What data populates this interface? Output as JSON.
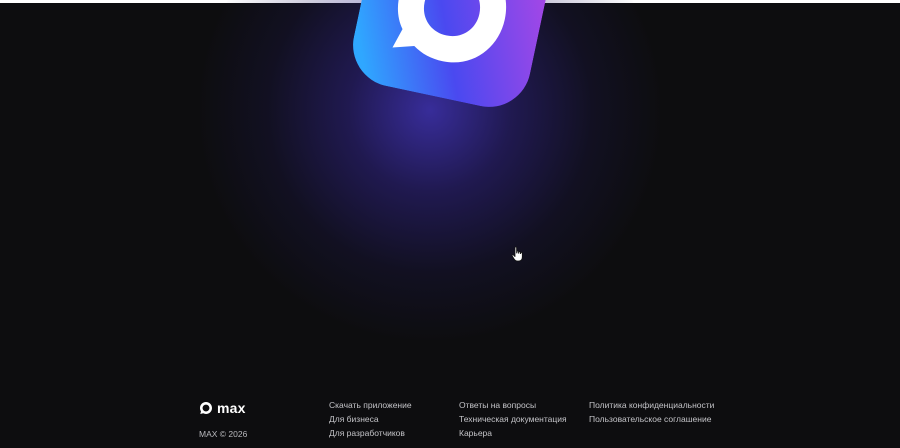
{
  "brand": {
    "name": "max",
    "copyright": "MAX © 2026"
  },
  "colors": {
    "background": "#0d0d0f",
    "glow": "#4637c8",
    "logo_gradient_start": "#2fa7ff",
    "logo_gradient_mid": "#4a49f0",
    "logo_gradient_end": "#a647e6"
  },
  "footer": {
    "columns": [
      {
        "links": [
          {
            "label": "Скачать приложение"
          },
          {
            "label": "Для бизнеса"
          },
          {
            "label": "Для разработчиков"
          }
        ]
      },
      {
        "links": [
          {
            "label": "Ответы на вопросы"
          },
          {
            "label": "Техническая документация"
          },
          {
            "label": "Карьера"
          }
        ]
      },
      {
        "links": [
          {
            "label": "Политика конфиденциальности"
          },
          {
            "label": "Пользовательское соглашение"
          }
        ]
      }
    ]
  },
  "icons": {
    "hero": "max-app-logo-icon",
    "brand": "max-logo-icon",
    "cursor": "hand-pointer-cursor-icon"
  }
}
